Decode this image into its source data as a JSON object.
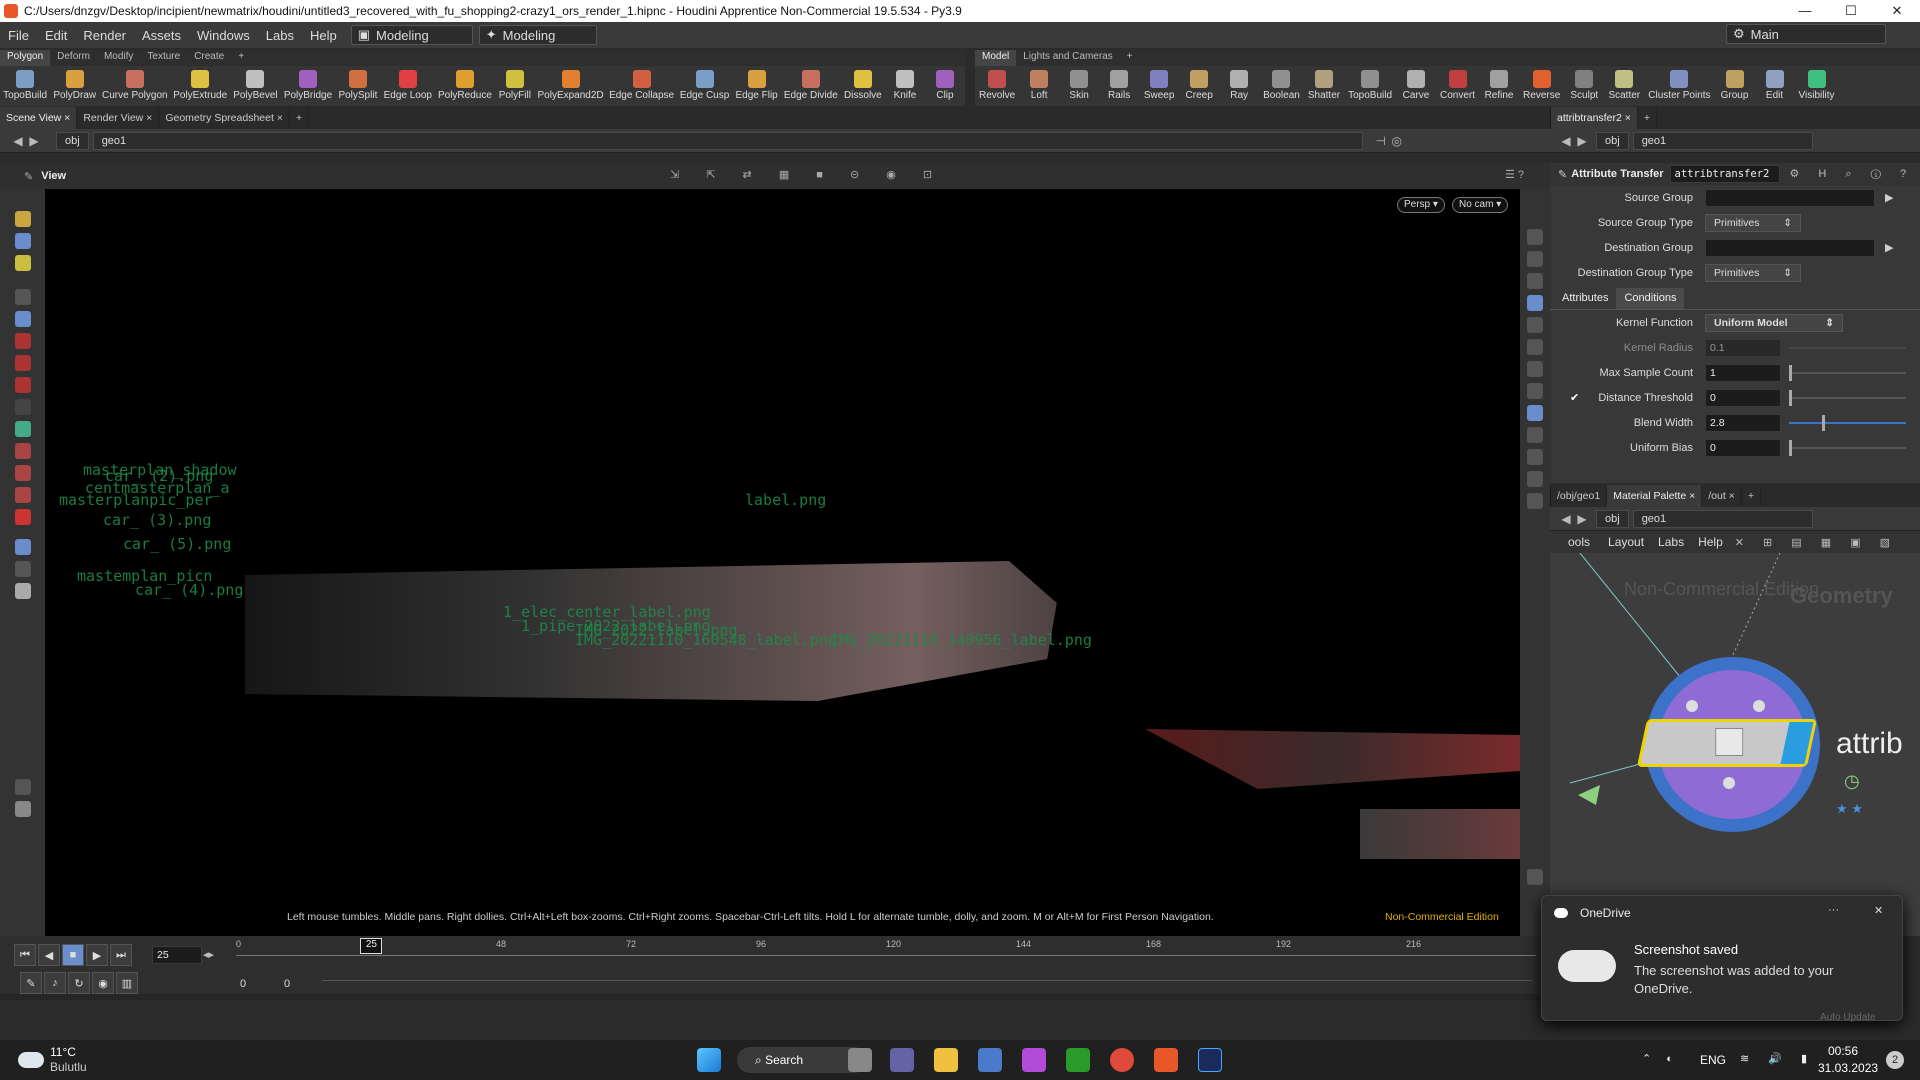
{
  "window": {
    "title": "C:/Users/dnzgv/Desktop/incipient/newmatrix/houdini/untitled3_recovered_with_fu_shopping2-crazy1_ors_render_1.hipnc - Houdini Apprentice Non-Commercial 19.5.534 - Py3.9",
    "minimize": "—",
    "maximize": "☐",
    "close": "✕"
  },
  "menu": {
    "items": [
      "File",
      "Edit",
      "Render",
      "Assets",
      "Windows",
      "Labs",
      "Help"
    ],
    "desktop_left": "Modeling",
    "desktop_right": "Modeling",
    "main_desk": "Main"
  },
  "shelf_left": {
    "tabs": [
      "Polygon",
      "Deform",
      "Modify",
      "Texture",
      "Create"
    ],
    "tools": [
      "TopoBuild",
      "PolyDraw",
      "Curve Polygon",
      "PolyExtrude",
      "PolyBevel",
      "PolyBridge",
      "PolySplit",
      "Edge Loop",
      "PolyReduce",
      "PolyFill",
      "PolyExpand2D",
      "Edge Collapse",
      "Edge Cusp",
      "Edge Flip",
      "Edge Divide",
      "Dissolve",
      "Knife",
      "Clip"
    ]
  },
  "shelf_right": {
    "tabs": [
      "Model",
      "Lights and Cameras"
    ],
    "tools": [
      "Revolve",
      "Loft",
      "Skin",
      "Rails",
      "Sweep",
      "Creep",
      "Ray",
      "Boolean",
      "Shatter",
      "TopoBuild",
      "Carve",
      "Convert",
      "Refine",
      "Reverse",
      "Sculpt",
      "Scatter",
      "Cluster Points",
      "Group",
      "Edit",
      "Visibility"
    ]
  },
  "viewer": {
    "tabs": [
      "Scene View",
      "Render View",
      "Geometry Spreadsheet"
    ],
    "path_obj": "obj",
    "path_geo": "geo1",
    "label": "View",
    "persp": "Persp ▾",
    "cam": "No cam ▾",
    "hint": "Left mouse tumbles. Middle pans. Right dollies. Ctrl+Alt+Left box-zooms. Ctrl+Right zooms. Spacebar-Ctrl-Left tilts. Hold L for alternate tumble, dolly, and zoom.    M or Alt+M for First Person Navigation.",
    "edition": "Non-Commercial Edition"
  },
  "viewport_labels": [
    "masterplan_shadow",
    "car_ (2).png",
    "centmasterplan_a",
    "masterplanpic_per",
    "car_ (3).png",
    "car_ (5).png",
    "mastemplan_picn",
    "car_ (4).png",
    "1_elec_center_label.png",
    "1_pipe_2022_label.png",
    "IMG_20221110_160548_label.png",
    "IMG_20221110_140956_label.png",
    "label.png",
    "IMG_2022_label.png"
  ],
  "params": {
    "tab": "attribtransfer2",
    "path_obj": "obj",
    "path_geo": "geo1",
    "node_type": "Attribute Transfer",
    "node_name": "attribtransfer2",
    "source_group": {
      "label": "Source Group",
      "value": ""
    },
    "source_group_type": {
      "label": "Source Group Type",
      "value": "Primitives"
    },
    "dest_group": {
      "label": "Destination Group",
      "value": ""
    },
    "dest_group_type": {
      "label": "Destination Group Type",
      "value": "Primitives"
    },
    "tabs": [
      "Attributes",
      "Conditions"
    ],
    "kernel_function": {
      "label": "Kernel Function",
      "value": "Uniform Model"
    },
    "kernel_radius": {
      "label": "Kernel Radius",
      "value": "0.1"
    },
    "max_sample": {
      "label": "Max Sample Count",
      "value": "1"
    },
    "distance_threshold": {
      "label": "Distance Threshold",
      "value": "0",
      "checked": true
    },
    "blend_width": {
      "label": "Blend Width",
      "value": "2.8",
      "slider": 0.28
    },
    "uniform_bias": {
      "label": "Uniform Bias",
      "value": "0"
    }
  },
  "network": {
    "tabs": [
      "/obj/geo1",
      "Material Palette",
      "/out"
    ],
    "path_obj": "obj",
    "path_geo": "geo1",
    "menu": [
      "ools",
      "Layout",
      "Labs",
      "Help"
    ],
    "watermark": "Non-Commercial Edition",
    "context": "Geometry",
    "node_label": "attrib"
  },
  "timeline": {
    "frame": "25",
    "current": "25",
    "ticks": [
      "0",
      "48",
      "72",
      "96",
      "120",
      "144",
      "168",
      "192",
      "216"
    ],
    "start": "0",
    "end": "0"
  },
  "notification": {
    "app": "OneDrive",
    "title": "Screenshot saved",
    "body": "The screenshot was added to your OneDrive.",
    "auto_update": "Auto Update"
  },
  "taskbar": {
    "weather_temp": "11°C",
    "weather_desc": "Bulutlu",
    "search": "Search",
    "lang": "ENG",
    "time": "00:56",
    "date": "31.03.2023",
    "badge": "2"
  },
  "colors": {
    "accent": "#f0d400",
    "node_purple": "#8f6bd6",
    "node_blue": "#3c73c8",
    "label_green": "#1d8a4a"
  }
}
